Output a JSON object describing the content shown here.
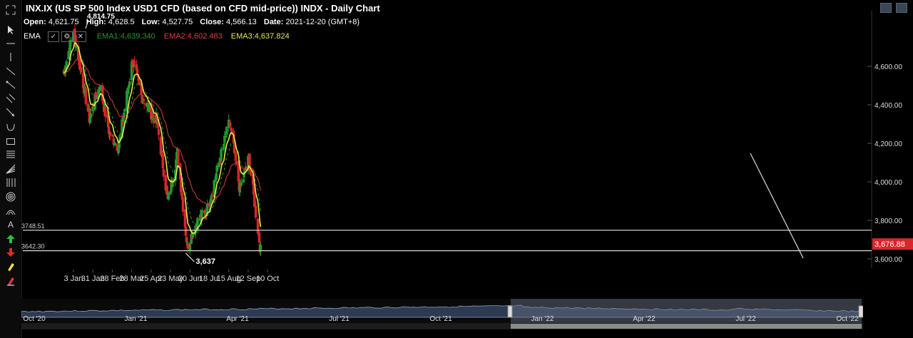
{
  "header": {
    "title": "INX.IX (US SP 500 Index USD1 CFD (based on CFD mid-price)) INDX - Daily Chart",
    "high_marker": "4,814.75",
    "ohlc": [
      {
        "k": "Open:",
        "v": "4,621.75"
      },
      {
        "k": "High:",
        "v": "4,628.5"
      },
      {
        "k": "Low:",
        "v": "4,527.75"
      },
      {
        "k": "Close:",
        "v": "4,566.13"
      },
      {
        "k": "Date:",
        "v": "2021-12-20 (GMT+8)"
      }
    ]
  },
  "indicator": {
    "name": "EMA",
    "ema1": "EMA1:4,639.340",
    "ema2": "EMA2:4,602.483",
    "ema3": "EMA3:4,637.824",
    "colors": {
      "ema1": "#1e9a2a",
      "ema2": "#c83a3a",
      "ema3": "#e8e84a"
    }
  },
  "colors": {
    "up": "#1f9a2f",
    "down": "#d8262a",
    "price_tag": "#d8262a",
    "background": "#000000"
  },
  "chart_data": {
    "type": "candlestick",
    "y_axis": {
      "ticks": [
        3600,
        3800,
        4000,
        4200,
        4400,
        4600
      ],
      "tick_labels": [
        "3,600.00",
        "3,800.00",
        "4,000.00",
        "4,200.00",
        "4,400.00",
        "4,600.00"
      ],
      "range": [
        3570,
        4850
      ]
    },
    "x_ticks": [
      "3 Jan",
      "31 Jan",
      "28 Feb",
      "28 Mar",
      "25 Apr",
      "23 May",
      "20 Jun",
      "18 Jul",
      "15 Aug",
      "12 Sep",
      "10 Oct"
    ],
    "current_price": "3,676.88",
    "levels": [
      {
        "value": 3748.51,
        "label": "3748.51"
      },
      {
        "value": 3642.3,
        "label": "3642.30"
      }
    ],
    "low_annotation": {
      "value": 3637,
      "label": "3,637"
    },
    "series_key_points": [
      {
        "date": "2021-12-20",
        "price": 4566
      },
      {
        "date": "2022-01-03",
        "price": 4790
      },
      {
        "date": "2022-01-26",
        "price": 4330
      },
      {
        "date": "2022-02-10",
        "price": 4500
      },
      {
        "date": "2022-02-24",
        "price": 4250
      },
      {
        "date": "2022-03-09",
        "price": 4180
      },
      {
        "date": "2022-03-29",
        "price": 4630
      },
      {
        "date": "2022-04-11",
        "price": 4450
      },
      {
        "date": "2022-05-04",
        "price": 4300
      },
      {
        "date": "2022-05-19",
        "price": 3900
      },
      {
        "date": "2022-06-02",
        "price": 4150
      },
      {
        "date": "2022-06-16",
        "price": 3670
      },
      {
        "date": "2022-06-30",
        "price": 3790
      },
      {
        "date": "2022-07-15",
        "price": 3860
      },
      {
        "date": "2022-08-16",
        "price": 4310
      },
      {
        "date": "2022-08-31",
        "price": 3960
      },
      {
        "date": "2022-09-13",
        "price": 4120
      },
      {
        "date": "2022-09-30",
        "price": 3640
      }
    ]
  },
  "navigator": {
    "labels": [
      "Oct '20",
      "Jan '21",
      "Apr '21",
      "Jul '21",
      "Oct '21",
      "Jan '22",
      "Apr '22",
      "Jul '22",
      "Oct '22"
    ]
  }
}
